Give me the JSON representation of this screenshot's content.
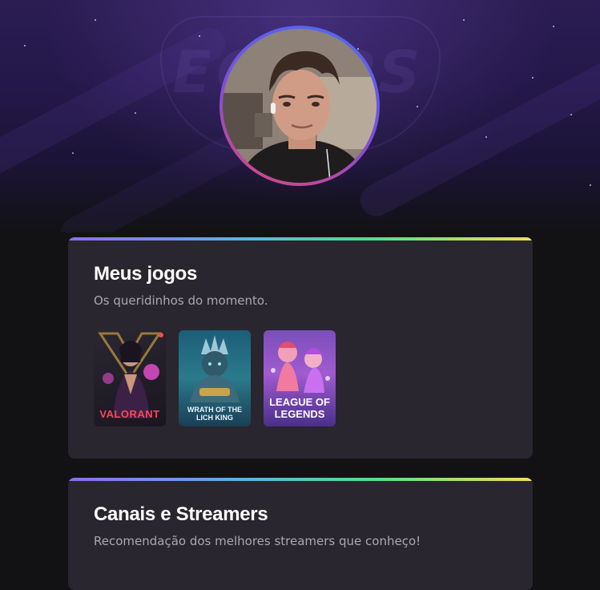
{
  "hero": {
    "background_logo_text": "ECLIPS"
  },
  "profile": {
    "avatar_alt": "Foto de perfil"
  },
  "games_card": {
    "title": "Meus jogos",
    "subtitle": "Os queridinhos do momento.",
    "games": [
      {
        "name": "VALORANT",
        "accent": "#ff4655"
      },
      {
        "name": "WRATH OF THE LICH KING",
        "accent": "#8fd0ff"
      },
      {
        "name": "LEAGUE OF LEGENDS",
        "accent": "#ffffff"
      }
    ]
  },
  "streamers_card": {
    "title": "Canais e Streamers",
    "subtitle": "Recomendação dos melhores streamers que conheço!"
  },
  "colors": {
    "page_bg": "#121214",
    "card_bg": "#29262f",
    "gradient": [
      "#8e6cf3",
      "#5bb6e0",
      "#4fe08a",
      "#f3df5a"
    ]
  }
}
